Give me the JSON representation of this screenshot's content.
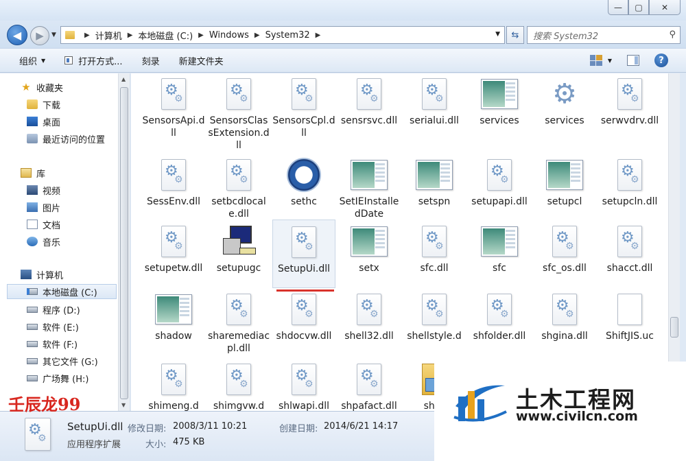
{
  "window": {
    "min_glyph": "—",
    "max_glyph": "▢",
    "close_glyph": "✕"
  },
  "address": {
    "crumbs": [
      "计算机",
      "本地磁盘 (C:)",
      "Windows",
      "System32"
    ],
    "search_placeholder": "搜索 System32"
  },
  "toolbar": {
    "organize": "组织",
    "open_with": "打开方式...",
    "burn": "刻录",
    "new_folder": "新建文件夹"
  },
  "nav": {
    "favorites": "收藏夹",
    "downloads": "下载",
    "desktop": "桌面",
    "recent": "最近访问的位置",
    "libraries": "库",
    "videos": "视频",
    "pictures": "图片",
    "documents": "文档",
    "music": "音乐",
    "computer": "计算机",
    "drive_c": "本地磁盘 (C:)",
    "drive_d": "程序 (D:)",
    "drive_e": "软件 (E:)",
    "drive_f": "软件 (F:)",
    "drive_g": "其它文件 (G:)",
    "drive_h": "广场舞 (H:)"
  },
  "files": [
    {
      "name": "SensorsApi.dll",
      "icon": "dll-icon"
    },
    {
      "name": "SensorsClassExtension.dll",
      "icon": "dll-icon"
    },
    {
      "name": "SensorsCpl.dll",
      "icon": "dll-icon"
    },
    {
      "name": "sensrsvc.dll",
      "icon": "dll-icon"
    },
    {
      "name": "serialui.dll",
      "icon": "dll-icon"
    },
    {
      "name": "services",
      "icon": "window-icon"
    },
    {
      "name": "services",
      "icon": "gears-icon"
    },
    {
      "name": "serwvdrv.dll",
      "icon": "dll-icon"
    },
    {
      "name": "SessEnv.dll",
      "icon": "dll-icon"
    },
    {
      "name": "setbcdlocale.dll",
      "icon": "dll-icon"
    },
    {
      "name": "sethc",
      "icon": "accessibility-icon"
    },
    {
      "name": "SetIEInstalledDate",
      "icon": "window-icon"
    },
    {
      "name": "setspn",
      "icon": "window-icon"
    },
    {
      "name": "setupapi.dll",
      "icon": "dll-icon"
    },
    {
      "name": "setupcl",
      "icon": "window-icon"
    },
    {
      "name": "setupcln.dll",
      "icon": "dll-icon"
    },
    {
      "name": "setupetw.dll",
      "icon": "dll-icon"
    },
    {
      "name": "setupugc",
      "icon": "setup-icon"
    },
    {
      "name": "SetupUi.dll",
      "icon": "dll-icon"
    },
    {
      "name": "setx",
      "icon": "window-icon"
    },
    {
      "name": "sfc.dll",
      "icon": "dll-icon"
    },
    {
      "name": "sfc",
      "icon": "window-icon"
    },
    {
      "name": "sfc_os.dll",
      "icon": "dll-icon"
    },
    {
      "name": "shacct.dll",
      "icon": "dll-icon"
    },
    {
      "name": "shadow",
      "icon": "window-icon"
    },
    {
      "name": "sharemediacpl.dll",
      "icon": "dll-icon"
    },
    {
      "name": "shdocvw.dll",
      "icon": "dll-icon"
    },
    {
      "name": "shell32.dll",
      "icon": "dll-icon"
    },
    {
      "name": "shellstyle.d",
      "icon": "dll-icon"
    },
    {
      "name": "shfolder.dll",
      "icon": "dll-icon"
    },
    {
      "name": "shgina.dll",
      "icon": "dll-icon"
    },
    {
      "name": "ShiftJIS.uc",
      "icon": "blank-file-icon"
    },
    {
      "name": "shimeng.d",
      "icon": "dll-icon"
    },
    {
      "name": "shimgvw.d",
      "icon": "dll-icon"
    },
    {
      "name": "shlwapi.dll",
      "icon": "dll-icon"
    },
    {
      "name": "shpafact.dll",
      "icon": "dll-icon"
    },
    {
      "name": "shrp",
      "icon": "shortcut-icon"
    }
  ],
  "selected_file": "SetupUi.dll",
  "details": {
    "name": "SetupUi.dll",
    "type": "应用程序扩展",
    "modified_label": "修改日期:",
    "modified_value": "2008/3/11 10:21",
    "created_label": "创建日期:",
    "created_value": "2014/6/21 14:17",
    "size_label": "大小:",
    "size_value": "475 KB"
  },
  "watermark": {
    "author": "壬辰龙99",
    "site_title": "土木工程网",
    "site_url": "www.civilcn.com"
  },
  "colors": {
    "accent_red": "#d9322b",
    "selection_bg": "#eef3f9",
    "toolbar_bg": "#dde8f5"
  }
}
